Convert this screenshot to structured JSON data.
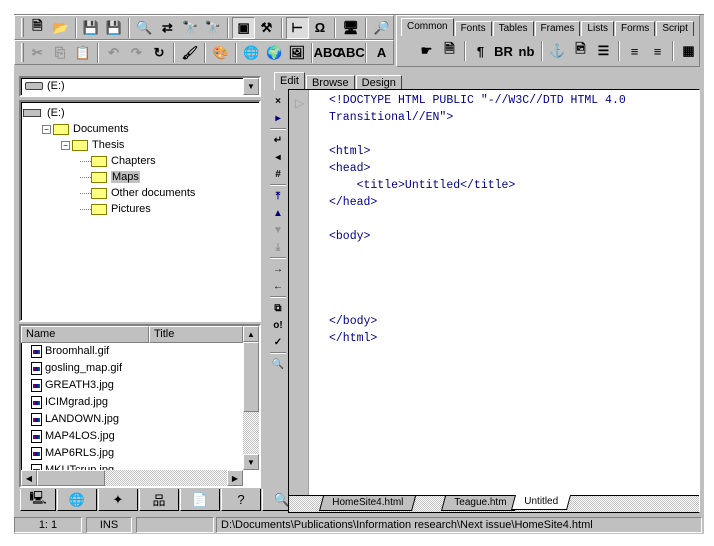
{
  "toolbar_main": {
    "row1": [
      {
        "icon": "new-file-icon",
        "glyph": "🗎"
      },
      {
        "icon": "open-file-icon",
        "glyph": "📂"
      },
      {
        "icon": "save-icon",
        "glyph": "💾",
        "disabled": true
      },
      {
        "icon": "save-all-icon",
        "glyph": "💾"
      },
      {
        "icon": "find-icon",
        "glyph": "🔍"
      },
      {
        "icon": "replace-icon",
        "glyph": "⇄"
      },
      {
        "icon": "extended-find-icon",
        "glyph": "🔭"
      },
      {
        "icon": "extended-replace-icon",
        "glyph": "🔭"
      },
      {
        "icon": "toggle-resource-tab-icon",
        "glyph": "▣"
      },
      {
        "icon": "edit-tag-icon",
        "glyph": "⚒"
      },
      {
        "icon": "toggle-tag-insight-icon",
        "glyph": "⊢"
      },
      {
        "icon": "special-characters-icon",
        "glyph": "Ω"
      },
      {
        "icon": "browse-icon",
        "glyph": "🖥"
      },
      {
        "icon": "preview-dropdown-icon",
        "glyph": "🔎"
      }
    ],
    "row2": [
      {
        "icon": "cut-icon",
        "glyph": "✂",
        "disabled": true
      },
      {
        "icon": "copy-icon",
        "glyph": "⎘",
        "disabled": true
      },
      {
        "icon": "paste-icon",
        "glyph": "📋"
      },
      {
        "icon": "undo-icon",
        "glyph": "↶",
        "disabled": true
      },
      {
        "icon": "redo-icon",
        "glyph": "↷",
        "disabled": true
      },
      {
        "icon": "reload-icon",
        "glyph": "↻"
      },
      {
        "icon": "clean-up-icon",
        "glyph": "🖌"
      },
      {
        "icon": "color-palette-icon",
        "glyph": "🎨"
      },
      {
        "icon": "link-verification-icon",
        "glyph": "🌐"
      },
      {
        "icon": "validate-icon",
        "glyph": "🌍"
      },
      {
        "icon": "thumbnails-icon",
        "glyph": "🖼"
      },
      {
        "icon": "spell-check-icon",
        "glyph": "ABC"
      },
      {
        "icon": "mark-spelling-errors-icon",
        "glyph": "ABC"
      },
      {
        "icon": "font-tag-icon",
        "glyph": "A"
      }
    ]
  },
  "quickbar": {
    "tabs": [
      "Common",
      "Fonts",
      "Tables",
      "Frames",
      "Lists",
      "Forms",
      "Script"
    ],
    "active_tab": "Common",
    "buttons": [
      {
        "icon": "quickstart-icon",
        "glyph": "☛"
      },
      {
        "icon": "document-icon",
        "glyph": "🗎"
      },
      {
        "icon": "paragraph-icon",
        "glyph": "¶"
      },
      {
        "icon": "line-break-icon",
        "glyph": "BR"
      },
      {
        "icon": "nonbreaking-space-icon",
        "glyph": "nb"
      },
      {
        "icon": "anchor-icon",
        "glyph": "⚓"
      },
      {
        "icon": "image-icon",
        "glyph": "🖻"
      },
      {
        "icon": "horizontal-rule-icon",
        "glyph": "☰"
      },
      {
        "icon": "center-icon",
        "glyph": "≡"
      },
      {
        "icon": "align-right-icon",
        "glyph": "≡"
      },
      {
        "icon": "table-icon",
        "glyph": "▦"
      }
    ]
  },
  "drive_select": {
    "value": "(E:)"
  },
  "tree": [
    {
      "label": "(E:)",
      "level": 0,
      "type": "drive"
    },
    {
      "label": "Documents",
      "level": 1,
      "type": "folder",
      "expanded": true
    },
    {
      "label": "Thesis",
      "level": 2,
      "type": "folder",
      "expanded": true
    },
    {
      "label": "Chapters",
      "level": 3,
      "type": "folder"
    },
    {
      "label": "Maps",
      "level": 3,
      "type": "folder-open",
      "selected": true
    },
    {
      "label": "Other documents",
      "level": 3,
      "type": "folder"
    },
    {
      "label": "Pictures",
      "level": 3,
      "type": "folder"
    }
  ],
  "file_list": {
    "columns": [
      "Name",
      "Title"
    ],
    "files": [
      "Broomhall.gif",
      "gosling_map.gif",
      "GREATH3.jpg",
      "ICIMgrad.jpg",
      "LANDOWN.jpg",
      "MAP4LOS.jpg",
      "MAP6RLS.jpg",
      "MKUTcrup.jpg"
    ]
  },
  "resource_tabs": [
    {
      "icon": "local-files-icon",
      "glyph": "🖳"
    },
    {
      "icon": "remote-files-icon",
      "glyph": "🌐"
    },
    {
      "icon": "projects-icon",
      "glyph": "✦"
    },
    {
      "icon": "site-view-icon",
      "glyph": "品"
    },
    {
      "icon": "snippets-icon",
      "glyph": "📄"
    },
    {
      "icon": "help-icon",
      "glyph": "?"
    },
    {
      "icon": "tag-inspector-icon",
      "glyph": "🔍"
    }
  ],
  "editor": {
    "tabs": [
      "Edit",
      "Browse",
      "Design"
    ],
    "active_tab": "Edit",
    "code": "<!DOCTYPE HTML PUBLIC \"-//W3C//DTD HTML 4.0\nTransitional//EN\">\n\n<html>\n<head>\n    <title>Untitled</title>\n</head>\n\n<body>\n\n\n\n\n</body>\n</html>",
    "doc_tabs": [
      "HomeSite4.html",
      "Teague.htm",
      "Untitled"
    ],
    "active_doc": "Untitled"
  },
  "editor_toolbar": [
    {
      "icon": "close-document-icon",
      "glyph": "×"
    },
    {
      "icon": "toggle-results-icon",
      "glyph": "▸"
    },
    {
      "icon": "word-wrap-icon",
      "glyph": "↵"
    },
    {
      "icon": "gutter-icon",
      "glyph": "◂"
    },
    {
      "icon": "line-numbers-icon",
      "glyph": "#"
    },
    {
      "icon": "goto-top-icon",
      "glyph": "⤒"
    },
    {
      "icon": "previous-bookmark-icon",
      "glyph": "▲"
    },
    {
      "icon": "next-bookmark-icon",
      "glyph": "▼"
    },
    {
      "icon": "goto-bottom-icon",
      "glyph": "⤓"
    },
    {
      "icon": "indent-icon",
      "glyph": "→"
    },
    {
      "icon": "unindent-icon",
      "glyph": "←"
    },
    {
      "icon": "tag-completion-icon",
      "glyph": "⧉"
    },
    {
      "icon": "tag-tips-icon",
      "glyph": "o!"
    },
    {
      "icon": "tag-validation-icon",
      "glyph": "✓"
    },
    {
      "icon": "code-sweeper-icon",
      "glyph": "🔍"
    }
  ],
  "status": {
    "position": "1: 1",
    "mode": "INS",
    "path": "D:\\Documents\\Publications\\Information research\\Next issue\\HomeSite4.html"
  }
}
